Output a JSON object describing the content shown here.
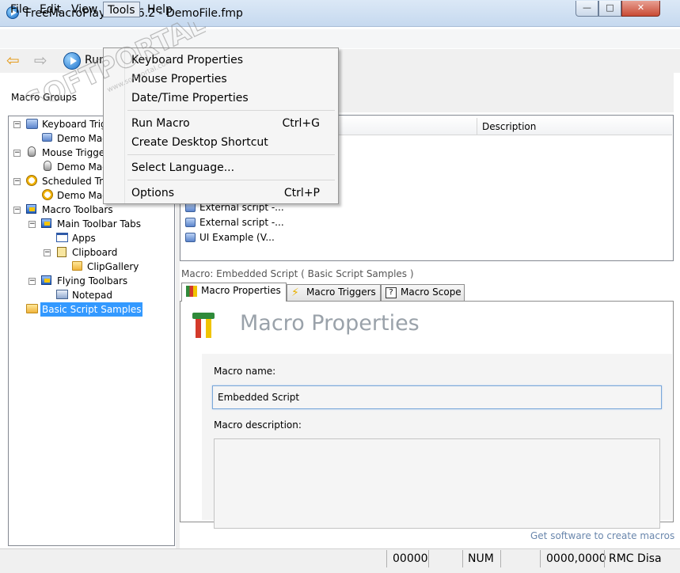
{
  "window": {
    "title": "FreeMacroPlayer v7.6.2 - DemoFile.fmp",
    "minimize": "—",
    "maximize": "□",
    "close": "✕"
  },
  "menubar": {
    "items": [
      "File",
      "Edit",
      "View",
      "Tools",
      "Help"
    ],
    "active": "Tools"
  },
  "toolbar": {
    "run_label": "Run",
    "back_icon": "arrow-left-icon",
    "forward_icon": "arrow-right-icon",
    "run_icon": "play-icon"
  },
  "sidebar": {
    "header": "Macro Groups",
    "tree": [
      {
        "label": "Keyboard Trig",
        "icon": "keyboard-icon"
      },
      {
        "label": "Demo Mac",
        "icon": "macro-icon"
      },
      {
        "label": "Mouse Trigge",
        "icon": "mouse-icon"
      },
      {
        "label": "Demo Mac",
        "icon": "mouse-icon"
      },
      {
        "label": "Scheduled Tri",
        "icon": "clock-icon"
      },
      {
        "label": "Demo Mac",
        "icon": "clock-icon"
      },
      {
        "label": "Macro Toolbars",
        "icon": "toolbar-icon"
      },
      {
        "label": "Main Toolbar Tabs",
        "icon": "toolbar-icon"
      },
      {
        "label": "Apps",
        "icon": "window-icon"
      },
      {
        "label": "Clipboard",
        "icon": "clipboard-icon"
      },
      {
        "label": "ClipGallery",
        "icon": "gallery-icon"
      },
      {
        "label": "Flying Toolbars",
        "icon": "toolbar-icon"
      },
      {
        "label": "Notepad",
        "icon": "notepad-icon"
      },
      {
        "label": "Basic Script Samples",
        "icon": "folder-open-icon",
        "selected": true
      }
    ]
  },
  "macro_list": {
    "columns": [
      "",
      "Description"
    ],
    "rows": [
      {
        "name": "External script -...",
        "description": ""
      },
      {
        "name": "External script -...",
        "description": ""
      },
      {
        "name": "UI Example (V...",
        "description": ""
      }
    ]
  },
  "detail": {
    "caption": "Macro: Embedded Script ( Basic Script Samples )",
    "tabs": [
      "Macro Properties",
      "Macro Triggers",
      "Macro Scope"
    ],
    "active_tab": "Macro Properties",
    "section_title": "Macro Properties",
    "name_label": "Macro name:",
    "name_value": "Embedded Script",
    "desc_label": "Macro description:",
    "desc_value": "",
    "link": "Get software to create macros"
  },
  "statusbar": {
    "cells": [
      "00000",
      "NUM",
      "0000,0000",
      "RMC Disa"
    ]
  },
  "tools_menu": {
    "items": [
      {
        "label": "Keyboard Properties",
        "shortcut": ""
      },
      {
        "label": "Mouse Properties",
        "shortcut": ""
      },
      {
        "label": "Date/Time Properties",
        "shortcut": ""
      },
      {
        "label": "Run Macro",
        "shortcut": "Ctrl+G"
      },
      {
        "label": "Create Desktop Shortcut",
        "shortcut": ""
      },
      {
        "label": "Select Language...",
        "shortcut": ""
      },
      {
        "label": "Options",
        "shortcut": "Ctrl+P"
      }
    ]
  },
  "watermark": {
    "text": "SOFTPORTAL",
    "sub": "www.softportal.com"
  }
}
